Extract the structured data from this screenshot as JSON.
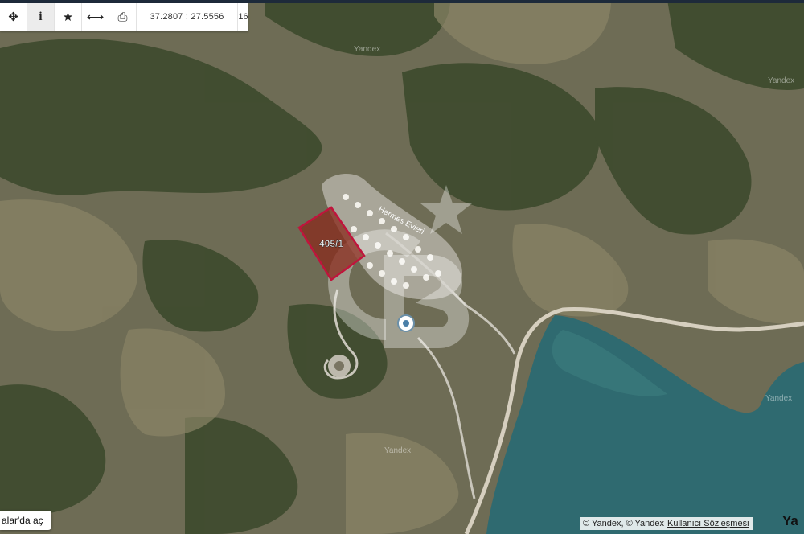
{
  "toolbar": {
    "tools": [
      {
        "icon": "move-icon",
        "glyph": "✥"
      },
      {
        "icon": "info-icon",
        "glyph": "i"
      },
      {
        "icon": "star-icon",
        "glyph": "★"
      },
      {
        "icon": "measure-icon",
        "glyph": "⟷"
      },
      {
        "icon": "print-icon",
        "glyph": "⎙"
      }
    ],
    "coordinates": "37.2807 : 27.5556",
    "zoom_level": "16"
  },
  "map": {
    "parcel_label": "405/1",
    "road_label": "Hermes Evleri",
    "watermark": "Yandex",
    "colors": {
      "sea": "#2f6a70",
      "land": "#6b6a52",
      "vegetation": "#3c4a2c",
      "road": "#d8d2c4",
      "parcel_border": "#c0143c",
      "parcel_fill": "#8a2a1c"
    }
  },
  "controls": {
    "open_button_label": "alar'da aç"
  },
  "attribution": {
    "text": "© Yandex, © Yandex",
    "link_label": "Kullanıcı Sözleşmesi",
    "logo_fragment": "Ya"
  }
}
